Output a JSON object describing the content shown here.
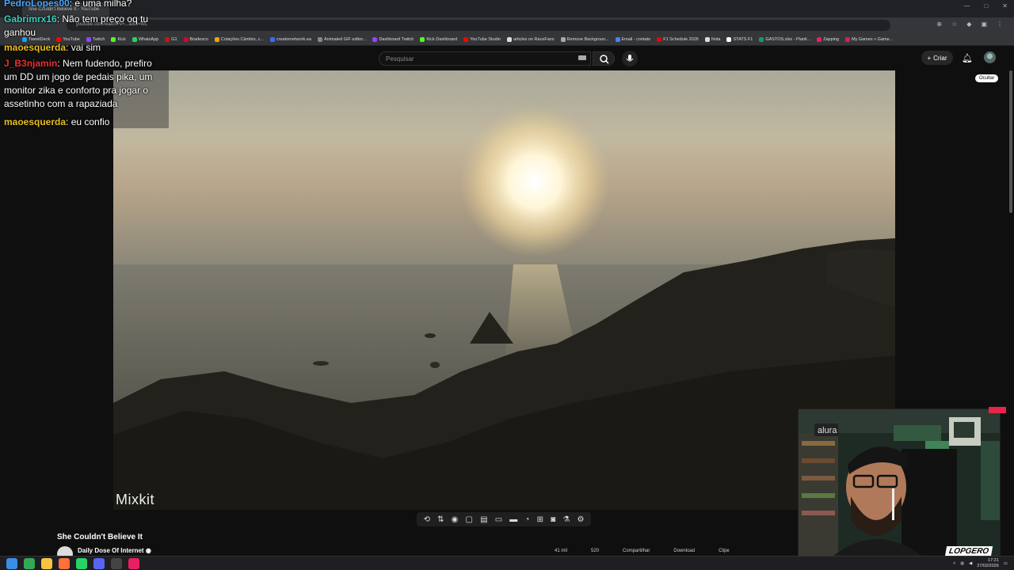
{
  "browser": {
    "tab_title": "She Couldn't Believe It - YouTube",
    "url": "youtube.com/watch?v=...&list=WL",
    "window_controls": [
      "—",
      "□",
      "✕"
    ],
    "bookmarks": [
      {
        "label": "TweetDeck",
        "color": "#1da1f2"
      },
      {
        "label": "YouTube",
        "color": "#ff0000"
      },
      {
        "label": "Twitch",
        "color": "#9146ff"
      },
      {
        "label": "Kick",
        "color": "#53fc18"
      },
      {
        "label": "WhatsApp",
        "color": "#25d366"
      },
      {
        "label": "G1",
        "color": "#c4170c"
      },
      {
        "label": "Bradesco",
        "color": "#cc092f"
      },
      {
        "label": "Cotações Câmbio, c...",
        "color": "#f4a300"
      },
      {
        "label": "creatornetwork.ea",
        "color": "#3a6df0"
      },
      {
        "label": "Animated GIF editor...",
        "color": "#888888"
      },
      {
        "label": "Dashboard Twitch",
        "color": "#9146ff"
      },
      {
        "label": "Kick Dashboard",
        "color": "#53fc18"
      },
      {
        "label": "YouTube Studio",
        "color": "#ff0000"
      },
      {
        "label": "articles on RaceFans",
        "color": "#dddddd"
      },
      {
        "label": "Remove Backgroun...",
        "color": "#aaaaaa"
      },
      {
        "label": "Email - contato",
        "color": "#4285f4"
      },
      {
        "label": "F1 Schedule 2026",
        "color": "#e10600"
      },
      {
        "label": "Nota",
        "color": "#dddddd"
      },
      {
        "label": "STATS F1",
        "color": "#ffffff"
      },
      {
        "label": "GASTOS.xlsx - Planil...",
        "color": "#0f9d58"
      },
      {
        "label": "Zapping",
        "color": "#e91e63"
      },
      {
        "label": "My Games » Game...",
        "color": "#d81b60"
      }
    ]
  },
  "youtube": {
    "search_placeholder": "Pesquisar",
    "create_label": "Criar",
    "hide_label": "Ocultar",
    "video_watermark": "Mixkit",
    "video_title": "She Couldn't Believe It",
    "channel_name": "Daily Dose Of Internet",
    "actions": [
      "41 mil",
      "520",
      "Compartilhar",
      "Download",
      "Clipe"
    ]
  },
  "chat": [
    {
      "nick": "PedroLopes00",
      "color": "#4aa8ff",
      "text": ": e uma milha?"
    },
    {
      "nick": "Gabrimrx16",
      "color": "#3cd0c0",
      "text": ": Não tem preço oq tu ganhou"
    },
    {
      "nick": "maoesquerda",
      "color": "#e8c020",
      "text": ": vai sim"
    },
    {
      "nick": "J_B3njamin",
      "color": "#e83030",
      "text": ": Nem fudendo, prefiro um DD um jogo de pedais pika, um monitor zika e conforto pra jogar o assetinho com a rapaziada"
    },
    {
      "nick": "maoesquerda",
      "color": "#e8c020",
      "text": ": eu confio"
    }
  ],
  "webcam": {
    "sign_text": "alura",
    "overlay_label": "LOPGERO"
  },
  "taskbar": {
    "time": "17:21",
    "date": "27/02/2026",
    "apps": [
      {
        "name": "windows",
        "color": "#3a8ee6"
      },
      {
        "name": "chrome",
        "color": "#34a853"
      },
      {
        "name": "explorer",
        "color": "#f5c542"
      },
      {
        "name": "firefox",
        "color": "#ff7139"
      },
      {
        "name": "whatsapp",
        "color": "#25d366"
      },
      {
        "name": "discord",
        "color": "#5865f2"
      },
      {
        "name": "obs",
        "color": "#444444"
      },
      {
        "name": "app",
        "color": "#e91e63"
      }
    ]
  }
}
